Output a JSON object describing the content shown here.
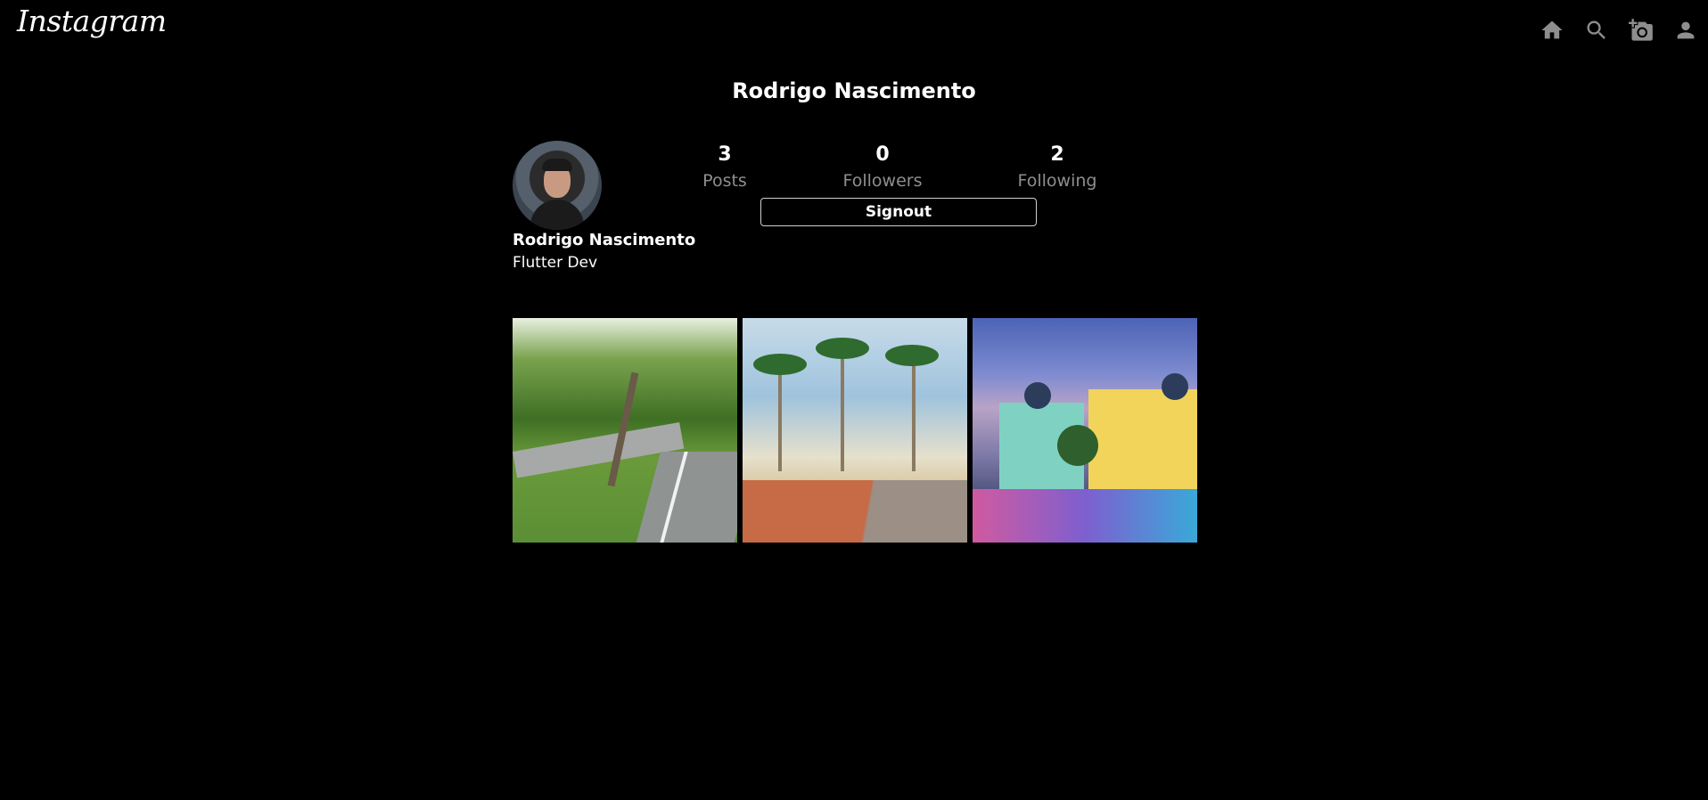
{
  "app_bar": {
    "logo": "Instagram",
    "actions": [
      {
        "icon": "home-icon"
      },
      {
        "icon": "search-icon"
      },
      {
        "icon": "add-photo-icon"
      },
      {
        "icon": "person-icon"
      }
    ],
    "icon_color": "#8e8e8e"
  },
  "profile": {
    "title": "Rodrigo Nascimento",
    "display_name": "Rodrigo Nascimento",
    "bio": "Flutter Dev",
    "stats": {
      "posts": {
        "value": "3",
        "label": "Posts"
      },
      "followers": {
        "value": "0",
        "label": "Followers"
      },
      "following": {
        "value": "2",
        "label": "Following"
      }
    },
    "signout_label": "Signout"
  },
  "posts": [
    {
      "scene": "park"
    },
    {
      "scene": "beach"
    },
    {
      "scene": "city"
    }
  ],
  "colors": {
    "background": "#000000",
    "text": "#ffffff",
    "muted": "#8e8e8e"
  }
}
